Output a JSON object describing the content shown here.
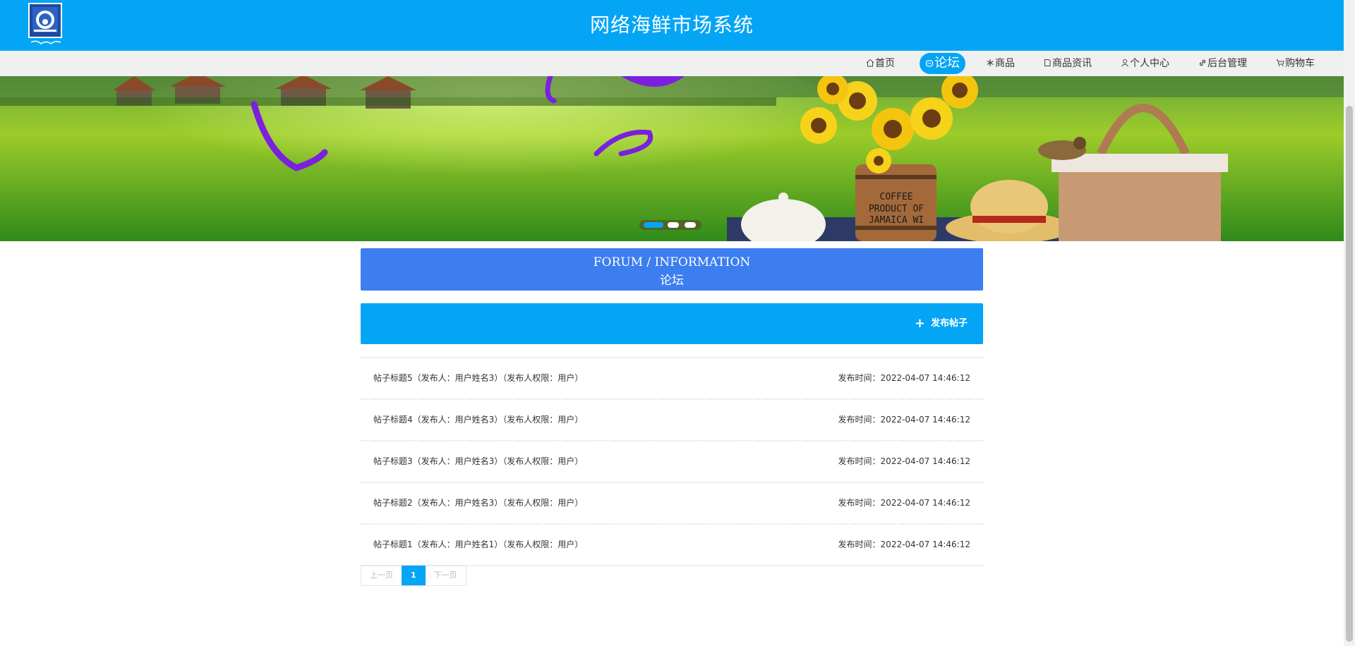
{
  "header": {
    "title": "网络海鲜市场系统",
    "brand_color": "#05a5f5"
  },
  "nav": {
    "items": [
      {
        "label": "首页",
        "icon": "home-icon"
      },
      {
        "label": "论坛",
        "icon": "forum-icon",
        "active": true
      },
      {
        "label": "商品",
        "icon": "snowflake-icon"
      },
      {
        "label": "商品资讯",
        "icon": "document-icon"
      },
      {
        "label": "个人中心",
        "icon": "user-icon"
      },
      {
        "label": "后台管理",
        "icon": "link-icon"
      },
      {
        "label": "购物车",
        "icon": "cart-icon"
      }
    ]
  },
  "banner": {
    "slide_count": 3,
    "active_slide": 1
  },
  "section": {
    "title_en": "FORUM / INFORMATION",
    "title_cn": "论坛",
    "color": "#3c7df0"
  },
  "actions": {
    "post_label": "发布帖子"
  },
  "posts": [
    {
      "title": "帖子标题5（发布人：用户姓名3）（发布人权限：用户）",
      "time": "发布时间：2022-04-07 14:46:12"
    },
    {
      "title": "帖子标题4（发布人：用户姓名3）（发布人权限：用户）",
      "time": "发布时间：2022-04-07 14:46:12"
    },
    {
      "title": "帖子标题3（发布人：用户姓名3）（发布人权限：用户）",
      "time": "发布时间：2022-04-07 14:46:12"
    },
    {
      "title": "帖子标题2（发布人：用户姓名3）（发布人权限：用户）",
      "time": "发布时间：2022-04-07 14:46:12"
    },
    {
      "title": "帖子标题1（发布人：用户姓名1）（发布人权限：用户）",
      "time": "发布时间：2022-04-07 14:46:12"
    }
  ],
  "pagination": {
    "prev_label": "上一页",
    "current_page": "1",
    "next_label": "下一页"
  }
}
